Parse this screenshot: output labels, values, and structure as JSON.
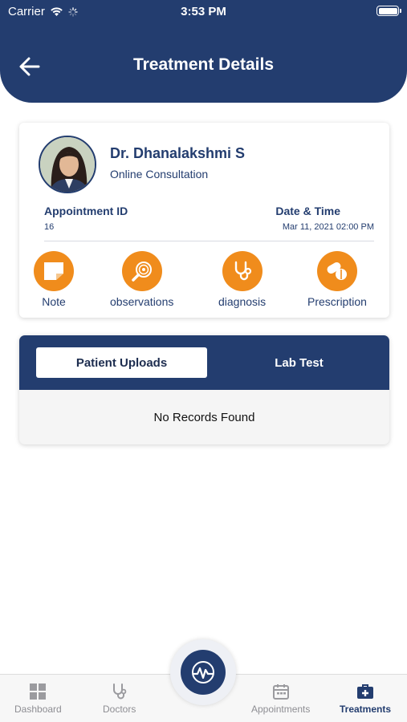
{
  "status_bar": {
    "carrier": "Carrier",
    "time": "3:53 PM"
  },
  "header": {
    "title": "Treatment Details"
  },
  "doctor": {
    "name": "Dr. Dhanalakshmi S",
    "consultation_type": "Online Consultation",
    "appointment_id_label": "Appointment ID",
    "appointment_id": "16",
    "datetime_label": "Date & Time",
    "datetime": "Mar 11, 2021 02:00 PM"
  },
  "actions": [
    {
      "label": "Note",
      "icon": "note-icon"
    },
    {
      "label": "observations",
      "icon": "magnifier-icon"
    },
    {
      "label": "diagnosis",
      "icon": "stethoscope-icon"
    },
    {
      "label": "Prescription",
      "icon": "pills-icon"
    }
  ],
  "uploads": {
    "tabs": [
      {
        "label": "Patient Uploads",
        "active": true
      },
      {
        "label": "Lab Test",
        "active": false
      }
    ],
    "empty_message": "No Records Found"
  },
  "bottom_nav": {
    "items": [
      {
        "label": "Dashboard",
        "icon": "dashboard-icon",
        "active": false
      },
      {
        "label": "Doctors",
        "icon": "stethoscope-icon",
        "active": false
      },
      {
        "label": "Appointments",
        "icon": "calendar-icon",
        "active": false
      },
      {
        "label": "Treatments",
        "icon": "medical-kit-icon",
        "active": true
      }
    ],
    "center_icon": "app-logo-icon"
  },
  "colors": {
    "primary": "#233d6f",
    "accent": "#f08c1c",
    "background": "#ffffff"
  }
}
